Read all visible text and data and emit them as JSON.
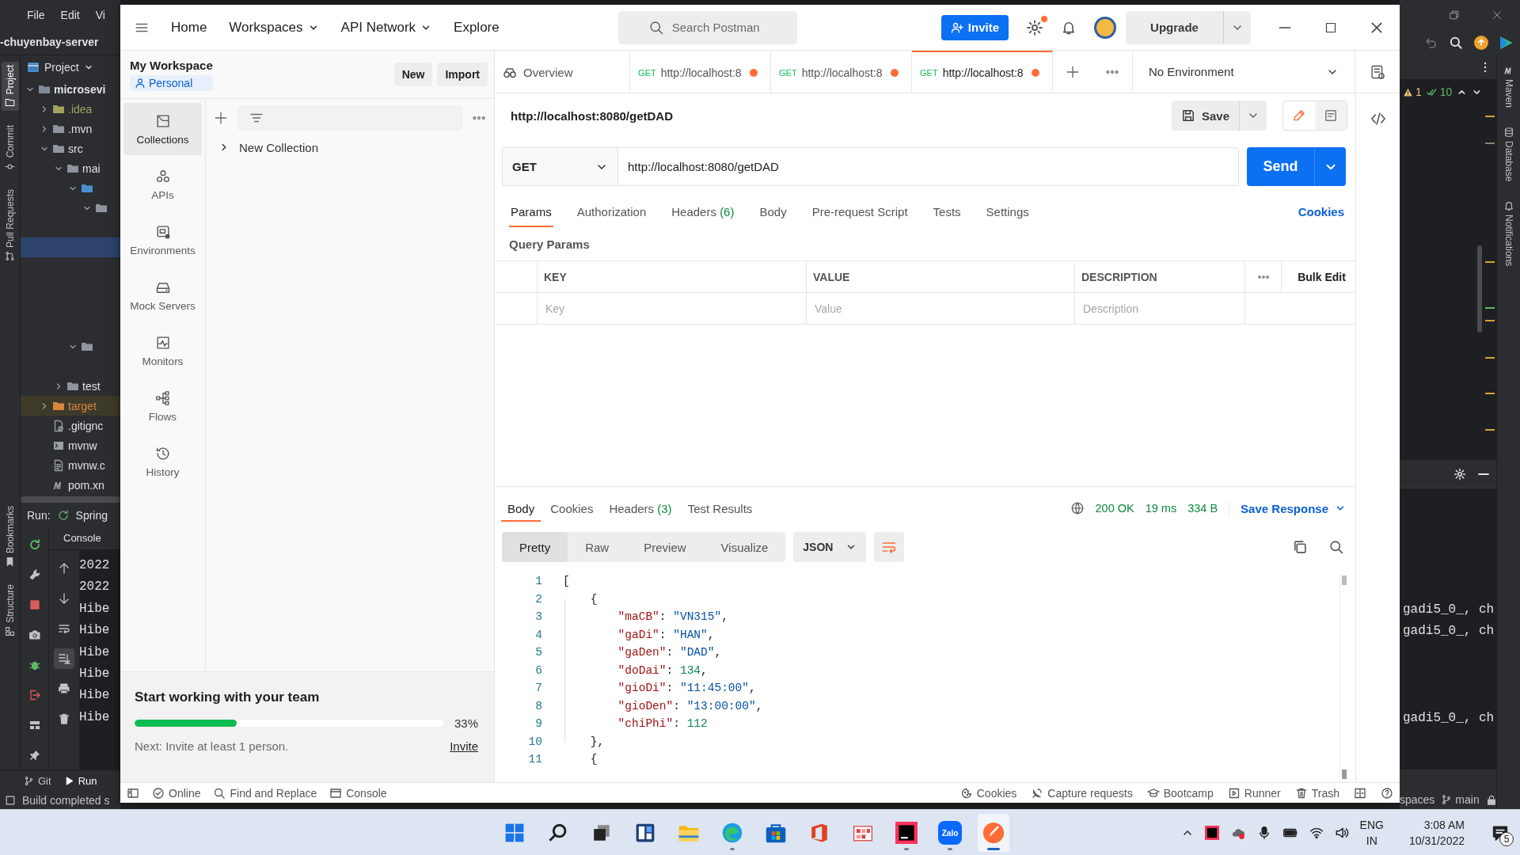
{
  "ide": {
    "menu": [
      {
        "label": "File"
      },
      {
        "label": "Edit"
      },
      {
        "label": "Vi"
      }
    ],
    "breadcrumb": "-chuyenbay-server",
    "left_stripe": [
      {
        "label": "Project",
        "kind": "project",
        "selected": true
      },
      {
        "label": "Commit",
        "kind": "commit",
        "selected": false
      },
      {
        "label": "Pull Requests",
        "kind": "pull",
        "selected": false
      }
    ],
    "left_stripe_bottom": [
      {
        "label": "Bookmarks",
        "kind": "bookmarks"
      },
      {
        "label": "Structure",
        "kind": "structure"
      }
    ],
    "project_title": "Project",
    "tree": [
      {
        "label": "microsevi",
        "kind": "module",
        "expanded": true,
        "selected": false,
        "children": [
          {
            "label": ".idea",
            "kind": "ignored-folder",
            "expanded": false,
            "selected": false
          },
          {
            "label": ".mvn",
            "kind": "folder",
            "expanded": false,
            "selected": false
          },
          {
            "label": "src",
            "kind": "folder",
            "expanded": true,
            "selected": false,
            "children": [
              {
                "label": "mai",
                "kind": "folder",
                "expanded": true,
                "selected": false,
                "children": [
                  {
                    "kind": "source-folder",
                    "expanded": true,
                    "selected": false,
                    "children": [
                      {
                        "kind": "package",
                        "expanded": true,
                        "selected": false,
                        "children": [
                          {
                            "selected": false
                          },
                          {
                            "selected": true
                          },
                          {
                            "selected": false
                          },
                          {
                            "selected": false
                          },
                          {
                            "selected": false
                          },
                          {
                            "selected": false
                          }
                        ]
                      }
                    ]
                  },
                  {
                    "kind": "resources-folder",
                    "expanded": true,
                    "selected": false,
                    "children": [
                      {
                        "selected": false
                      }
                    ]
                  }
                ]
              },
              {
                "label": "test",
                "kind": "folder",
                "expanded": false,
                "selected": false
              }
            ]
          },
          {
            "label": "target",
            "kind": "excluded-folder",
            "expanded": false,
            "selected": false
          },
          {
            "label": ".gitignc",
            "kind": "ignore-file",
            "selected": false
          },
          {
            "label": "mvnw",
            "kind": "script-file",
            "selected": false
          },
          {
            "label": "mvnw.c",
            "kind": "text-file",
            "selected": false
          },
          {
            "label": "pom.xn",
            "kind": "maven-file",
            "selected": false
          }
        ]
      }
    ],
    "run_label": "Run:",
    "run_config": "Spring",
    "console_tab": "Console",
    "console": [
      {
        "start": "2022"
      },
      {
        "start": "2022"
      },
      {
        "start": "Hibe",
        "end": "gadi5_0_, ch"
      },
      {
        "start": "Hibe",
        "end": "gadi5_0_, ch"
      },
      {
        "start": "Hibe"
      },
      {
        "start": "Hibe"
      },
      {
        "start": "Hibe"
      },
      {
        "start": "Hibe",
        "end": "gadi5_0_, ch"
      }
    ],
    "bottom_tabs": [
      {
        "label": "Git",
        "kind": "git",
        "selected": false
      },
      {
        "label": "Run",
        "kind": "run",
        "selected": true
      }
    ],
    "status": "Build completed s",
    "inspections": {
      "warnings": "1",
      "passed": "10"
    },
    "right_stripe": [
      {
        "label": "Maven",
        "kind": "maven"
      },
      {
        "label": "Database",
        "kind": "database"
      },
      {
        "label": "Notifications",
        "kind": "notifications"
      }
    ],
    "status_right": {
      "indent": "spaces",
      "branch": "main"
    }
  },
  "postman": {
    "header": {
      "nav": [
        {
          "label": "Home",
          "dropdown": false
        },
        {
          "label": "Workspaces",
          "dropdown": true
        },
        {
          "label": "API Network",
          "dropdown": true
        },
        {
          "label": "Explore",
          "dropdown": false
        }
      ],
      "search": {
        "placeholder": "Search Postman"
      },
      "invite": "Invite",
      "upgrade": "Upgrade"
    },
    "workspace": {
      "title": "My Workspace",
      "badge": "Personal",
      "buttons": [
        "New",
        "Import"
      ]
    },
    "sidebar": [
      {
        "label": "Collections",
        "kind": "collections",
        "selected": true
      },
      {
        "label": "APIs",
        "kind": "apis",
        "selected": false
      },
      {
        "label": "Environments",
        "kind": "environments",
        "selected": false
      },
      {
        "label": "Mock Servers",
        "kind": "mock",
        "selected": false
      },
      {
        "label": "Monitors",
        "kind": "monitors",
        "selected": false
      },
      {
        "label": "Flows",
        "kind": "flows",
        "selected": false
      },
      {
        "label": "History",
        "kind": "history",
        "selected": false
      }
    ],
    "collections": [
      {
        "label": "New Collection",
        "expanded": false
      }
    ],
    "onboarding": {
      "title": "Start working with your team",
      "level": 0.33,
      "percent": "33%",
      "next": "Next: Invite at least 1 person.",
      "link": "Invite"
    },
    "tabs": [
      {
        "kind": "overview",
        "label": "Overview",
        "selected": false
      },
      {
        "kind": "request",
        "method": "GET",
        "label": "http://localhost:8",
        "selected": false,
        "unsaved": true
      },
      {
        "kind": "request",
        "method": "GET",
        "label": "http://localhost:8",
        "selected": false,
        "unsaved": true
      },
      {
        "kind": "request",
        "method": "GET",
        "label": "http://localhost:8",
        "selected": true,
        "unsaved": true
      }
    ],
    "environment": "No Environment",
    "request": {
      "title": "http://localhost:8080/getDAD",
      "save": "Save",
      "method": "GET",
      "url": "http://localhost:8080/getDAD",
      "send": "Send",
      "tabs": [
        {
          "label": "Params",
          "selected": true
        },
        {
          "label": "Authorization",
          "selected": false
        },
        {
          "label": "Headers",
          "count": "(6)",
          "selected": false
        },
        {
          "label": "Body",
          "selected": false
        },
        {
          "label": "Pre-request Script",
          "selected": false
        },
        {
          "label": "Tests",
          "selected": false
        },
        {
          "label": "Settings",
          "selected": false
        }
      ],
      "cookies": "Cookies",
      "section": "Query Params",
      "columns": [
        "KEY",
        "VALUE",
        "DESCRIPTION"
      ],
      "bulk_edit": "Bulk Edit",
      "placeholders": [
        "Key",
        "Value",
        "Description"
      ]
    },
    "response": {
      "tabs": [
        {
          "label": "Body",
          "selected": true
        },
        {
          "label": "Cookies",
          "selected": false
        },
        {
          "label": "Headers",
          "count": "(3)",
          "selected": false
        },
        {
          "label": "Test Results",
          "selected": false
        }
      ],
      "status": "200 OK",
      "time": "19 ms",
      "size": "334 B",
      "save": "Save Response",
      "views": [
        {
          "label": "Pretty",
          "selected": true
        },
        {
          "label": "Raw",
          "selected": false
        },
        {
          "label": "Preview",
          "selected": false
        },
        {
          "label": "Visualize",
          "selected": false
        }
      ],
      "format": "JSON",
      "lines": [
        {
          "number": "1",
          "tokens": [
            {
              "kind": "punct",
              "text": "["
            }
          ]
        },
        {
          "number": "2",
          "tokens": [
            {
              "kind": "punct",
              "text": "    {"
            }
          ]
        },
        {
          "number": "3",
          "tokens": [
            {
              "kind": "key",
              "text": "        \"maCB\""
            },
            {
              "kind": "punct",
              "text": ": "
            },
            {
              "kind": "string",
              "text": "\"VN315\""
            },
            {
              "kind": "punct",
              "text": ","
            }
          ]
        },
        {
          "number": "4",
          "tokens": [
            {
              "kind": "key",
              "text": "        \"gaDi\""
            },
            {
              "kind": "punct",
              "text": ": "
            },
            {
              "kind": "string",
              "text": "\"HAN\""
            },
            {
              "kind": "punct",
              "text": ","
            }
          ]
        },
        {
          "number": "5",
          "tokens": [
            {
              "kind": "key",
              "text": "        \"gaDen\""
            },
            {
              "kind": "punct",
              "text": ": "
            },
            {
              "kind": "string",
              "text": "\"DAD\""
            },
            {
              "kind": "punct",
              "text": ","
            }
          ]
        },
        {
          "number": "6",
          "tokens": [
            {
              "kind": "key",
              "text": "        \"doDai\""
            },
            {
              "kind": "punct",
              "text": ": "
            },
            {
              "kind": "number",
              "text": "134"
            },
            {
              "kind": "punct",
              "text": ","
            }
          ]
        },
        {
          "number": "7",
          "tokens": [
            {
              "kind": "key",
              "text": "        \"gioDi\""
            },
            {
              "kind": "punct",
              "text": ": "
            },
            {
              "kind": "string",
              "text": "\"11:45:00\""
            },
            {
              "kind": "punct",
              "text": ","
            }
          ]
        },
        {
          "number": "8",
          "tokens": [
            {
              "kind": "key",
              "text": "        \"gioDen\""
            },
            {
              "kind": "punct",
              "text": ": "
            },
            {
              "kind": "string",
              "text": "\"13:00:00\""
            },
            {
              "kind": "punct",
              "text": ","
            }
          ]
        },
        {
          "number": "9",
          "tokens": [
            {
              "kind": "key",
              "text": "        \"chiPhi\""
            },
            {
              "kind": "punct",
              "text": ": "
            },
            {
              "kind": "number",
              "text": "112"
            }
          ]
        },
        {
          "number": "10",
          "tokens": [
            {
              "kind": "punct",
              "text": "    },"
            }
          ]
        },
        {
          "number": "11",
          "tokens": [
            {
              "kind": "punct",
              "text": "    {"
            }
          ]
        }
      ]
    },
    "status_bar": {
      "left": [
        {
          "kind": "online",
          "label": "Online"
        },
        {
          "kind": "find",
          "label": "Find and Replace"
        },
        {
          "kind": "console",
          "label": "Console"
        }
      ],
      "right": [
        {
          "kind": "cookies",
          "label": "Cookies"
        },
        {
          "kind": "capture",
          "label": "Capture requests"
        },
        {
          "kind": "bootcamp",
          "label": "Bootcamp"
        },
        {
          "kind": "runner",
          "label": "Runner"
        },
        {
          "kind": "trash",
          "label": "Trash"
        }
      ]
    }
  },
  "taskbar": {
    "apps": [
      {
        "kind": "start",
        "running": false,
        "active": false
      },
      {
        "kind": "search",
        "running": false,
        "active": false
      },
      {
        "kind": "taskview",
        "running": false,
        "active": false
      },
      {
        "kind": "widgets",
        "running": false,
        "active": false
      },
      {
        "kind": "explorer",
        "running": false,
        "active": false
      },
      {
        "kind": "edge",
        "running": true,
        "active": false
      },
      {
        "kind": "store",
        "running": false,
        "active": false
      },
      {
        "kind": "office",
        "running": false,
        "active": false
      },
      {
        "kind": "grid-app",
        "running": false,
        "active": false
      },
      {
        "kind": "intellij",
        "running": true,
        "active": false
      },
      {
        "kind": "zalo",
        "label": "Zalo",
        "running": true,
        "active": false
      },
      {
        "kind": "postman",
        "running": true,
        "active": true
      }
    ],
    "language": [
      "ENG",
      "IN"
    ],
    "time": "3:08 AM",
    "date": "10/31/2022",
    "notifications": "5"
  }
}
